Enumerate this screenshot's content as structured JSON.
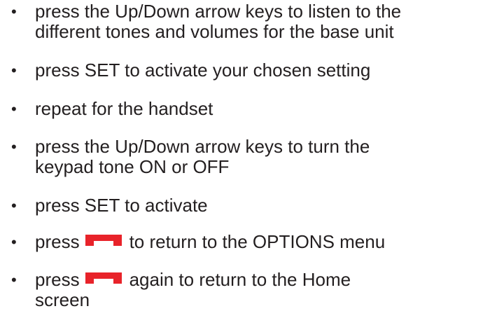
{
  "bullet_symbol": "•",
  "items": [
    {
      "line1": "press the Up/Down arrow keys to listen to the",
      "line2": "different tones and volumes for the base unit"
    },
    {
      "line1": "press SET to activate your chosen setting"
    },
    {
      "line1": "repeat for the handset"
    },
    {
      "line1": "press the Up/Down arrow keys to turn the",
      "line2": "keypad tone ON or OFF"
    },
    {
      "line1": "press SET to activate"
    },
    {
      "before_icon": "press",
      "icon": "hang-up-key-icon",
      "after_icon": "to return to the OPTIONS menu"
    },
    {
      "before_icon": "press",
      "icon": "hang-up-key-icon",
      "after_icon": "again to return to the Home",
      "line2": "screen"
    }
  ],
  "colors": {
    "text": "#231f20",
    "hang_up_key": "#e8232a"
  }
}
